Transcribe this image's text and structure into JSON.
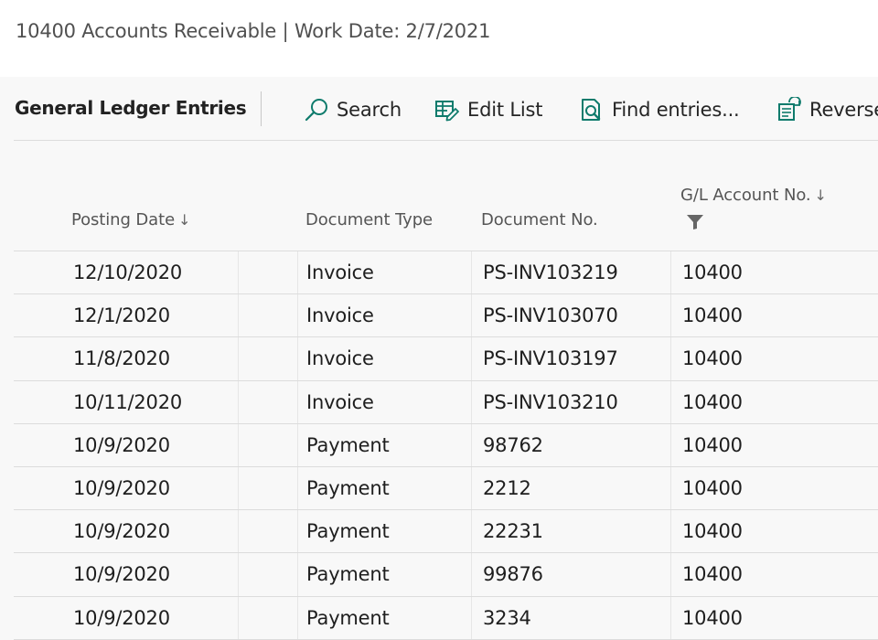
{
  "window": {
    "title": "10400 Accounts Receivable | Work Date: 2/7/2021"
  },
  "actionbar": {
    "caption": "General Ledger Entries",
    "actions": [
      {
        "label": "Search",
        "icon": "search-icon"
      },
      {
        "label": "Edit List",
        "icon": "edit-list-icon"
      },
      {
        "label": "Find entries...",
        "icon": "find-entries-icon"
      },
      {
        "label": "Reverse",
        "icon": "reverse-icon"
      }
    ]
  },
  "table": {
    "columns": {
      "posting_date": "Posting Date",
      "document_type": "Document Type",
      "document_no": "Document No.",
      "gl_account_no": "G/L Account No."
    },
    "sort_indicator": "↓",
    "rows": [
      {
        "posting_date": "12/10/2020",
        "document_type": "Invoice",
        "document_no": "PS-INV103219",
        "gl_account_no": "10400"
      },
      {
        "posting_date": "12/1/2020",
        "document_type": "Invoice",
        "document_no": "PS-INV103070",
        "gl_account_no": "10400"
      },
      {
        "posting_date": "11/8/2020",
        "document_type": "Invoice",
        "document_no": "PS-INV103197",
        "gl_account_no": "10400"
      },
      {
        "posting_date": "10/11/2020",
        "document_type": "Invoice",
        "document_no": "PS-INV103210",
        "gl_account_no": "10400"
      },
      {
        "posting_date": "10/9/2020",
        "document_type": "Payment",
        "document_no": "98762",
        "gl_account_no": "10400"
      },
      {
        "posting_date": "10/9/2020",
        "document_type": "Payment",
        "document_no": "2212",
        "gl_account_no": "10400"
      },
      {
        "posting_date": "10/9/2020",
        "document_type": "Payment",
        "document_no": "22231",
        "gl_account_no": "10400"
      },
      {
        "posting_date": "10/9/2020",
        "document_type": "Payment",
        "document_no": "99876",
        "gl_account_no": "10400"
      },
      {
        "posting_date": "10/9/2020",
        "document_type": "Payment",
        "document_no": "3234",
        "gl_account_no": "10400"
      }
    ]
  },
  "colors": {
    "accent": "#0f7b6c",
    "background": "#f8f8f8",
    "header_bg": "#ffffff",
    "divider": "#dcdcdc"
  }
}
